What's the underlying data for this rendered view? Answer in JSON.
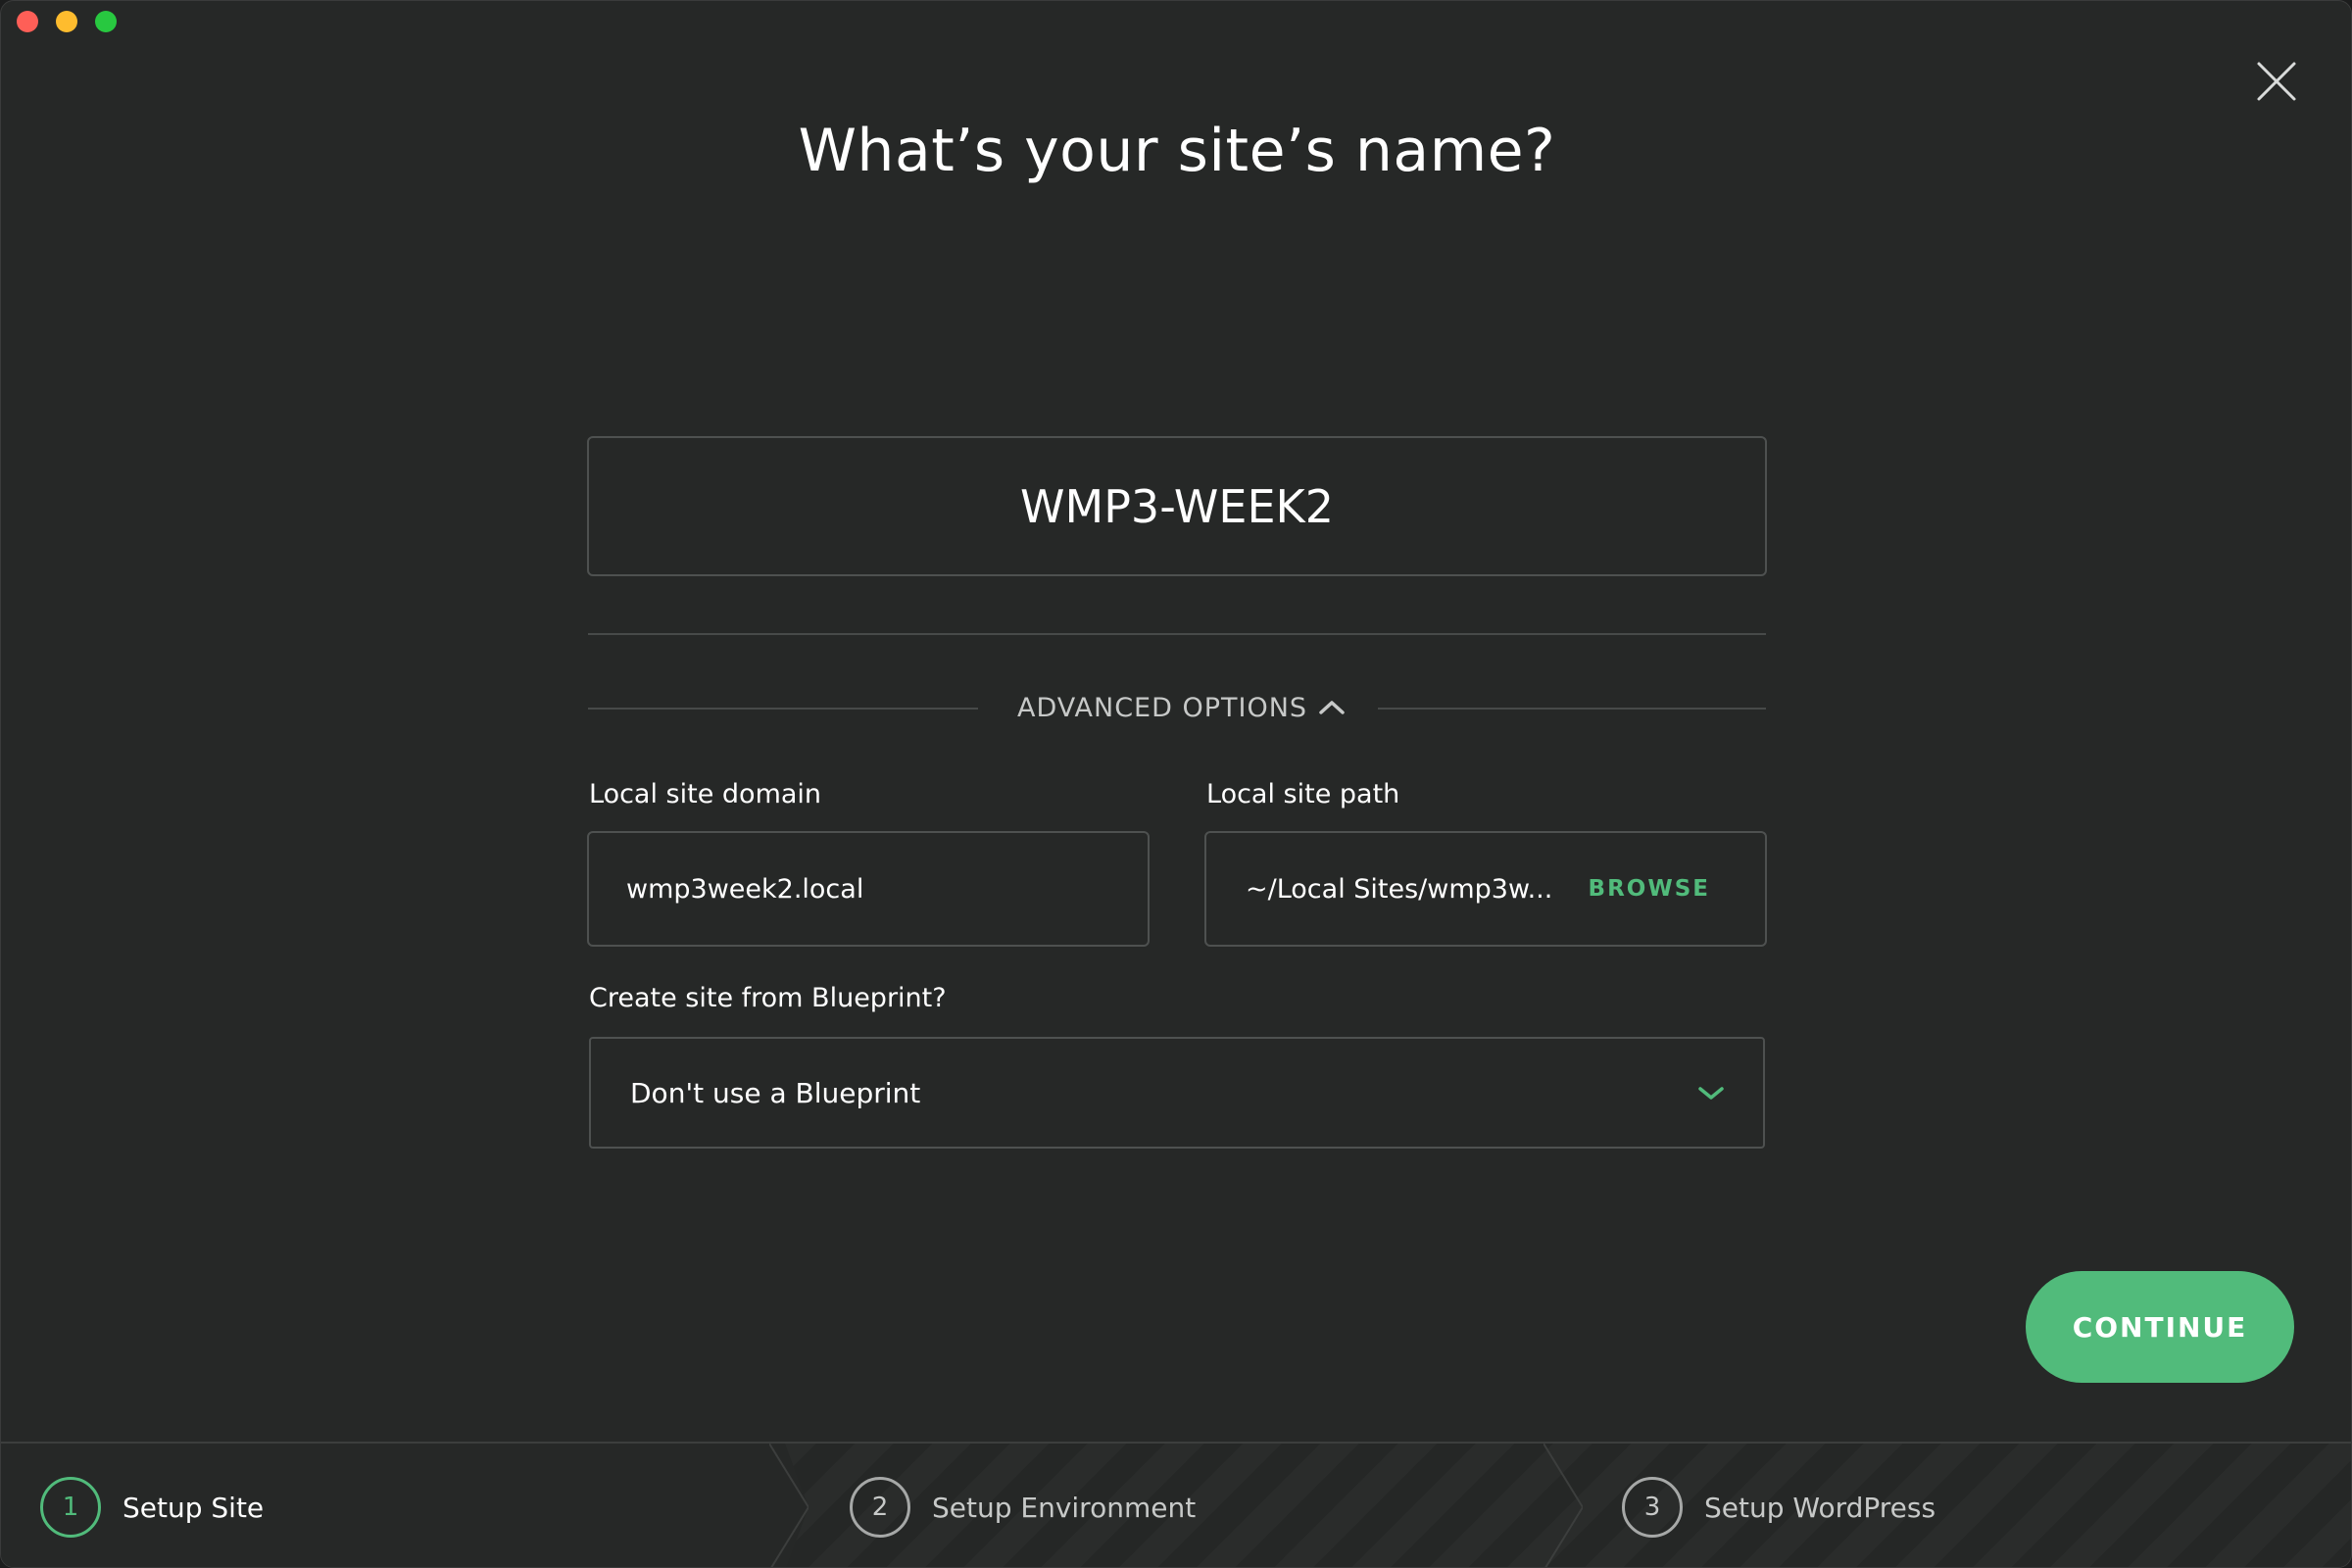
{
  "window": {
    "traffic_lights": [
      "close",
      "minimize",
      "maximize"
    ]
  },
  "header": {
    "title": "What’s your site’s name?",
    "close_icon": "close-icon"
  },
  "site_name": {
    "value": "WMP3-WEEK2"
  },
  "advanced": {
    "label": "ADVANCED OPTIONS",
    "icon": "chevron-up-icon",
    "expanded": true
  },
  "domain": {
    "label": "Local site domain",
    "value": "wmp3week2.local"
  },
  "path": {
    "label": "Local site path",
    "value": "~/Local Sites/wmp3w...",
    "browse_label": "BROWSE"
  },
  "blueprint": {
    "label": "Create site from Blueprint?",
    "selected": "Don't use a Blueprint",
    "icon": "chevron-down-icon"
  },
  "actions": {
    "continue_label": "CONTINUE"
  },
  "steps": [
    {
      "number": "1",
      "label": "Setup Site",
      "active": true
    },
    {
      "number": "2",
      "label": "Setup Environment",
      "active": false
    },
    {
      "number": "3",
      "label": "Setup WordPress",
      "active": false
    }
  ],
  "colors": {
    "accent": "#51bb7b",
    "background": "#262827",
    "border": "#4e5150"
  }
}
